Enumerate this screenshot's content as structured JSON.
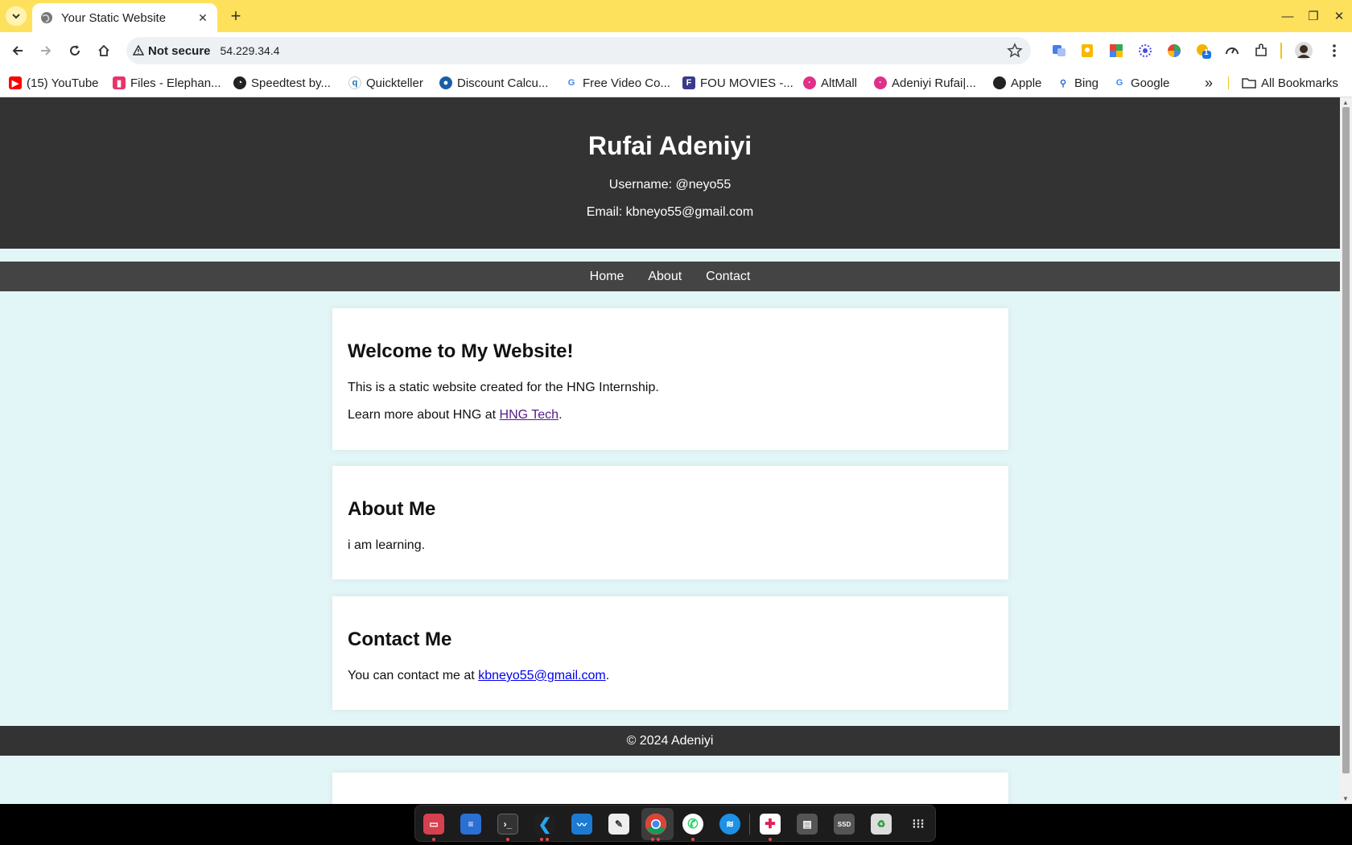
{
  "browser": {
    "tab_title": "Your Static Website",
    "security_label": "Not secure",
    "url": "54.229.34.4",
    "extension_badge": "1"
  },
  "bookmarks": [
    {
      "label": "(15) YouTube",
      "icon": "youtube-icon",
      "color": "#ff0000"
    },
    {
      "label": "Files - Elephan...",
      "icon": "files-icon",
      "color": "#e8336b"
    },
    {
      "label": "Speedtest by...",
      "icon": "speedtest-icon",
      "color": "#222222"
    },
    {
      "label": "Quickteller",
      "icon": "quickteller-icon",
      "color": "#1b6fb5"
    },
    {
      "label": "Discount Calcu...",
      "icon": "discount-icon",
      "color": "#1a5ea8"
    },
    {
      "label": "Free Video Co...",
      "icon": "google-icon",
      "color": "#4285f4"
    },
    {
      "label": "FOU MOVIES -...",
      "icon": "fou-icon",
      "color": "#3a3a8a"
    },
    {
      "label": "AltMall",
      "icon": "altmall-icon",
      "color": "#e0308a"
    },
    {
      "label": "Adeniyi Rufai|...",
      "icon": "adeniyi-icon",
      "color": "#e0308a"
    },
    {
      "label": "Apple",
      "icon": "apple-icon",
      "color": "#222222"
    },
    {
      "label": "Bing",
      "icon": "bing-icon",
      "color": "#2b6fd6"
    },
    {
      "label": "Google",
      "icon": "google-icon",
      "color": "#4285f4"
    }
  ],
  "bookmarks_overflow": "»",
  "all_bookmarks": "All Bookmarks",
  "site": {
    "name": "Rufai Adeniyi",
    "username": "Username: @neyo55",
    "email": "Email: kbneyo55@gmail.com",
    "nav": [
      "Home",
      "About",
      "Contact"
    ],
    "welcome": {
      "heading": "Welcome to My Website!",
      "body": "This is a static website created for the HNG Internship.",
      "learn_prefix": "Learn more about HNG at ",
      "learn_link": "HNG Tech",
      "learn_suffix": "."
    },
    "about": {
      "heading": "About Me",
      "body": "i am learning."
    },
    "contact": {
      "heading": "Contact Me",
      "prefix": "You can contact me at ",
      "link": "kbneyo55@gmail.com",
      "suffix": "."
    },
    "footer": "© 2024 Adeniyi"
  },
  "colors": {
    "tabbar": "#fde15c",
    "header": "#333333",
    "nav": "#444444",
    "page_bg": "#e3f6f7"
  },
  "dock_apps": [
    "files-icon",
    "text-editor-icon",
    "terminal-icon",
    "vscode-icon",
    "system-monitor-icon",
    "notes-icon",
    "chrome-icon",
    "whatsapp-icon",
    "docker-icon",
    "slack-icon",
    "disks-icon",
    "ssd-icon",
    "trash-icon",
    "app-grid-icon"
  ]
}
